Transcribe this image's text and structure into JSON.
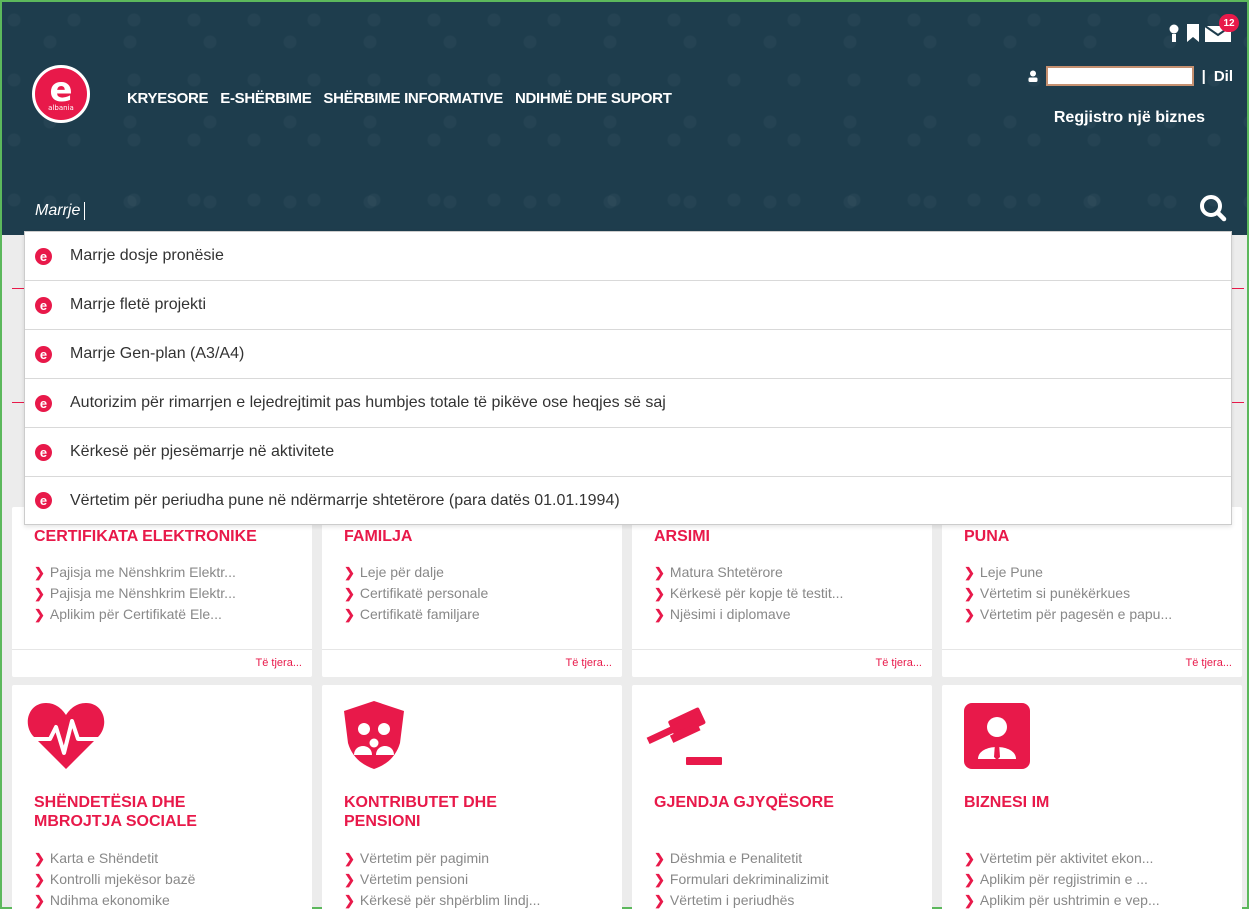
{
  "header": {
    "logo_letter": "e",
    "logo_sub": "albania",
    "nav": [
      "KRYESORE",
      "E-SHËRBIME",
      "SHËRBIME INFORMATIVE",
      "NDIHMË DHE SUPORT"
    ],
    "notification_count": "12",
    "separator": "|",
    "logout": "Dil",
    "register_business": "Regjistro një biznes",
    "search_value": "Marrje"
  },
  "dropdown": {
    "items": [
      "Marrje dosje pronësie",
      "Marrje fletë projekti",
      "Marrje Gen-plan (A3/A4)",
      "Autorizim për rimarrjen e lejedrejtimit pas humbjes totale të pikëve ose heqjes së saj",
      "Kërkesë për pjesëmarrje në aktivitete",
      "Vërtetim për periudha pune në ndërmarrje shtetërore (para datës 01.01.1994)"
    ]
  },
  "cards_row1": [
    {
      "title": "CERTIFIKATA ELEKTRONIKE",
      "links": [
        "Pajisja me Nënshkrim Elektr...",
        "Pajisja me Nënshkrim Elektr...",
        "Aplikim për Certifikatë Ele..."
      ],
      "more": "Të tjera..."
    },
    {
      "title": "FAMILJA",
      "links": [
        "Leje për dalje",
        "Certifikatë personale",
        "Certifikatë familjare"
      ],
      "more": "Të tjera..."
    },
    {
      "title": "ARSIMI",
      "links": [
        "Matura Shtetërore",
        "Kërkesë për kopje të testit...",
        "Njësimi i diplomave"
      ],
      "more": "Të tjera..."
    },
    {
      "title": "PUNA",
      "links": [
        "Leje Pune",
        "Vërtetim si punëkërkues",
        "Vërtetim për pagesën e papu..."
      ],
      "more": "Të tjera..."
    }
  ],
  "cards_row2": [
    {
      "icon": "heart-pulse-icon",
      "title_line1": "SHËNDETËSIA DHE",
      "title_line2": "MBROJTJA SOCIALE",
      "links": [
        "Karta e Shëndetit",
        "Kontrolli mjekësor bazë",
        "Ndihma ekonomike"
      ]
    },
    {
      "icon": "family-shield-icon",
      "title_line1": "KONTRIBUTET DHE",
      "title_line2": "PENSIONI",
      "links": [
        "Vërtetim për pagimin",
        "Vërtetim pensioni",
        "Kërkesë për shpërblim lindj..."
      ]
    },
    {
      "icon": "gavel-icon",
      "title_line1": "GJENDJA GJYQËSORE",
      "title_line2": "",
      "links": [
        "Dëshmia e Penalitetit",
        "Formulari dekriminalizimit",
        "Vërtetim i periudhës"
      ]
    },
    {
      "icon": "businessman-icon",
      "title_line1": "BIZNESI IM",
      "title_line2": "",
      "links": [
        "Vërtetim për aktivitet ekon...",
        "Aplikim për regjistrimin e ...",
        "Aplikim për ushtrimin e vep..."
      ]
    }
  ],
  "colors": {
    "accent": "#e8194a",
    "header_bg": "#1e3d4d",
    "link_gray": "#888888"
  }
}
